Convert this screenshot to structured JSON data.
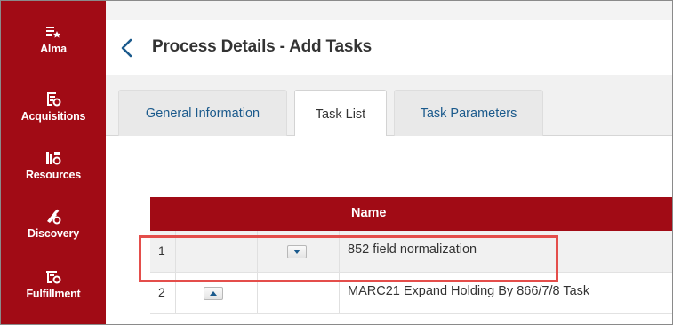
{
  "sidebar": {
    "items": [
      {
        "label": "Alma",
        "icon": "alma-star-menu-icon"
      },
      {
        "label": "Acquisitions",
        "icon": "acquisitions-icon"
      },
      {
        "label": "Resources",
        "icon": "resources-icon"
      },
      {
        "label": "Discovery",
        "icon": "discovery-icon"
      },
      {
        "label": "Fulfillment",
        "icon": "fulfillment-icon"
      }
    ]
  },
  "header": {
    "title": "Process Details - Add Tasks",
    "back_icon": "chevron-left-icon"
  },
  "tabs": [
    {
      "label": "General Information",
      "active": false
    },
    {
      "label": "Task List",
      "active": true
    },
    {
      "label": "Task Parameters",
      "active": false
    }
  ],
  "table": {
    "columns": {
      "name": "Name"
    },
    "rows": [
      {
        "num": "1",
        "name": "852 field normalization",
        "move": "down"
      },
      {
        "num": "2",
        "name": "MARC21 Expand Holding By 866/7/8 Task",
        "move": "up"
      }
    ]
  },
  "colors": {
    "brand": "#a10b15",
    "highlight": "#e44e4b",
    "tab_link": "#1b5a8c"
  }
}
